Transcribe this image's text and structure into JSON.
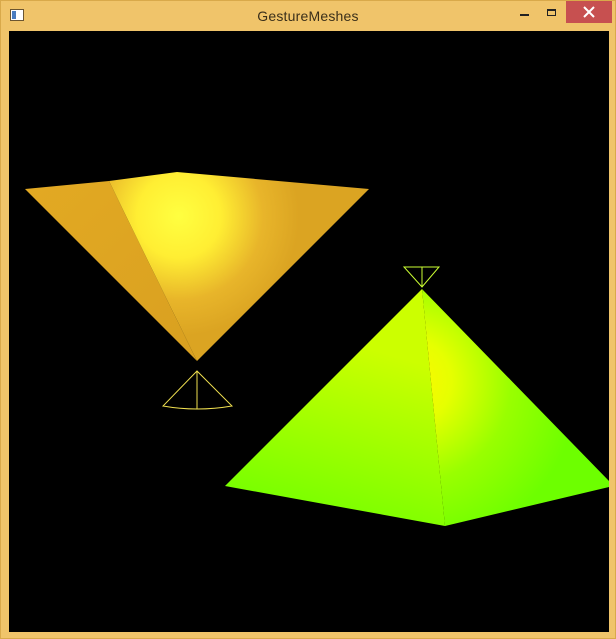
{
  "window": {
    "title": "GestureMeshes",
    "frame_color": "#f0c46a",
    "close_color": "#c75050"
  },
  "titlebar": {
    "app_icon": "window-app-icon",
    "minimize_icon": "minimize-icon",
    "maximize_icon": "maximize-icon",
    "close_icon": "close-icon"
  },
  "scene": {
    "background": "#000000",
    "meshes": [
      {
        "name": "orange-inverted-pyramid",
        "base_color": "#e0a523",
        "highlight_color": "#ffff33"
      },
      {
        "name": "green-pyramid",
        "base_color": "#77ff00",
        "highlight_color": "#f0ff00"
      }
    ],
    "wireframe_markers": [
      {
        "name": "yellow-cone-marker",
        "color": "#f0e050"
      },
      {
        "name": "green-cone-marker",
        "color": "#ccff33"
      }
    ]
  }
}
